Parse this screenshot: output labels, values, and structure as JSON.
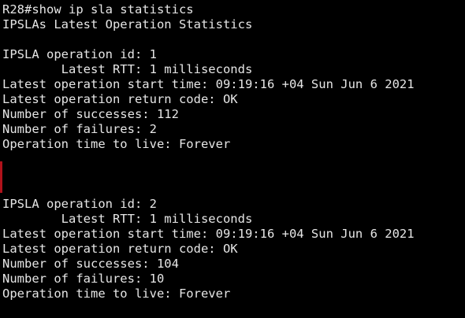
{
  "terminal": {
    "prompt": "R28#",
    "command": "show ip sla statistics",
    "header": "IPSLAs Latest Operation Statistics",
    "operations": [
      {
        "id_line": "IPSLA operation id: 1",
        "rtt_line": "        Latest RTT: 1 milliseconds",
        "start_time_line": "Latest operation start time: 09:19:16 +04 Sun Jun 6 2021",
        "return_code_line": "Latest operation return code: OK",
        "successes_line": "Number of successes: 112",
        "failures_line": "Number of failures: 2",
        "ttl_line": "Operation time to live: Forever"
      },
      {
        "id_line": "IPSLA operation id: 2",
        "rtt_line": "        Latest RTT: 1 milliseconds",
        "start_time_line": "Latest operation start time: 09:19:16 +04 Sun Jun 6 2021",
        "return_code_line": "Latest operation return code: OK",
        "successes_line": "Number of successes: 104",
        "failures_line": "Number of failures: 10",
        "ttl_line": "Operation time to live: Forever"
      }
    ]
  },
  "colors": {
    "background": "#000000",
    "text": "#e6e6e6",
    "accent_bar": "#b0121b"
  }
}
